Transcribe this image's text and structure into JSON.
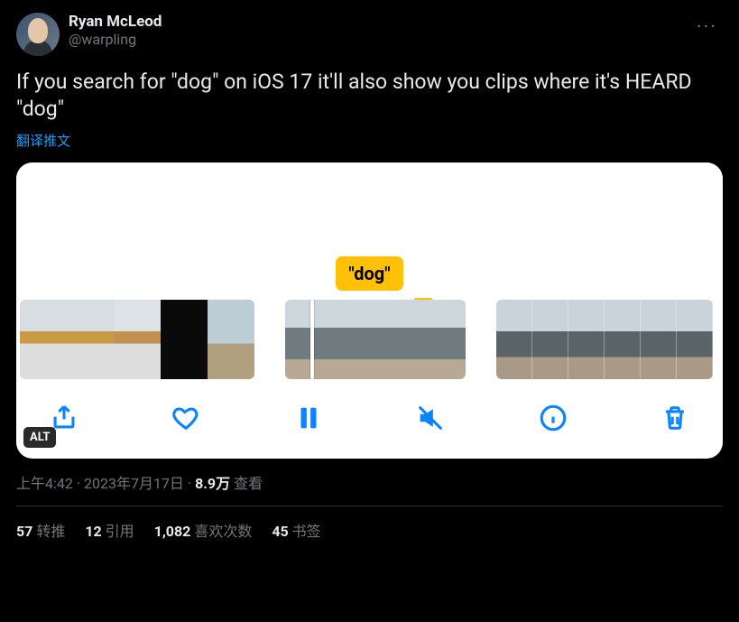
{
  "author": {
    "display_name": "Ryan McLeod",
    "handle": "@warpling"
  },
  "more_glyph": "···",
  "body": "If you search for \"dog\" on iOS 17 it'll also show you clips where it's HEARD \"dog\"",
  "translate_label": "翻译推文",
  "media": {
    "dog_tag": "\"dog\"",
    "alt_badge": "ALT"
  },
  "meta": {
    "time": "上午4:42",
    "sep": " · ",
    "date": "2023年7月17日",
    "views_count": "8.9万",
    "views_label": " 查看"
  },
  "stats": {
    "retweet_count": "57",
    "retweet_label": " 转推",
    "quote_count": "12",
    "quote_label": " 引用",
    "like_count": "1,082",
    "like_label": " 喜欢次数",
    "bookmark_count": "45",
    "bookmark_label": " 书签"
  }
}
